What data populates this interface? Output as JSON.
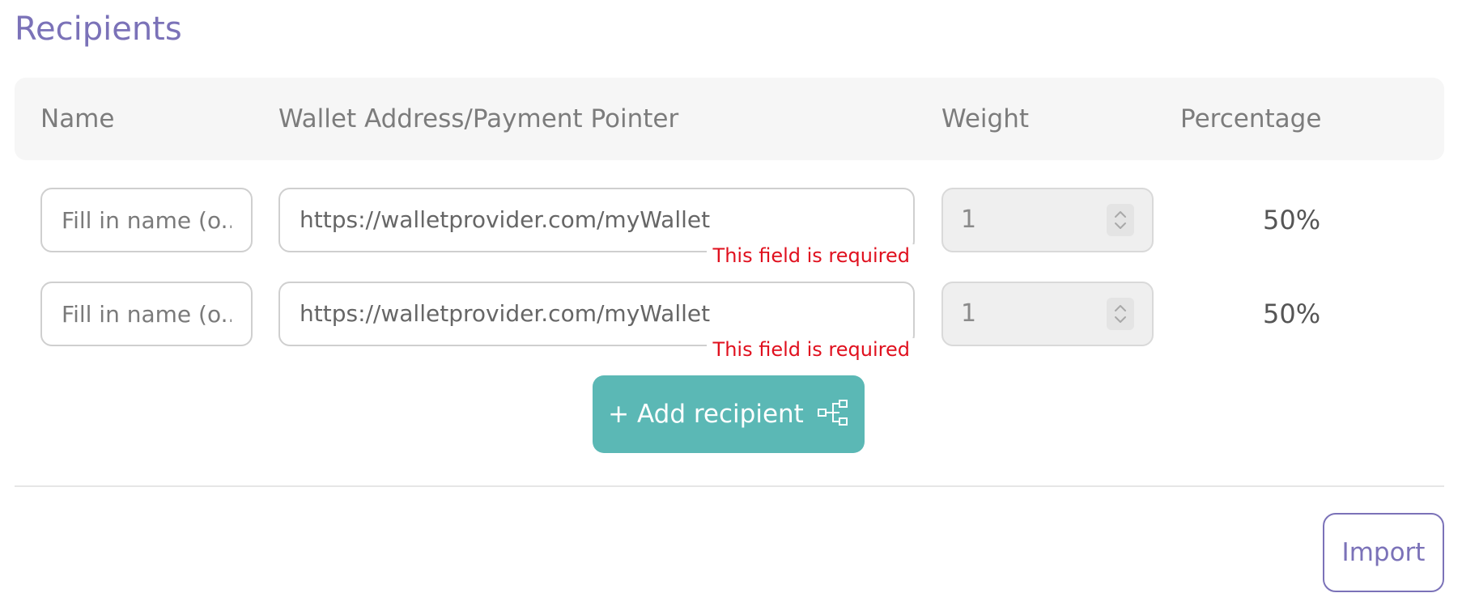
{
  "section": {
    "title": "Recipients"
  },
  "table": {
    "headers": {
      "name": "Name",
      "wallet": "Wallet Address/Payment Pointer",
      "weight": "Weight",
      "percentage": "Percentage"
    },
    "rows": [
      {
        "name_placeholder": "Fill in name (o...",
        "wallet_value": "https://walletprovider.com/myWallet",
        "error": "This field is required",
        "weight": "1",
        "percentage": "50%"
      },
      {
        "name_placeholder": "Fill in name (o...",
        "wallet_value": "https://walletprovider.com/myWallet",
        "error": "This field is required",
        "weight": "1",
        "percentage": "50%"
      }
    ]
  },
  "actions": {
    "add_label": "+ Add recipient",
    "add_icon": "split-icon",
    "import_label": "Import"
  },
  "colors": {
    "accent": "#7b72b8",
    "button_teal": "#5bb8b5",
    "error": "#e0101e"
  }
}
